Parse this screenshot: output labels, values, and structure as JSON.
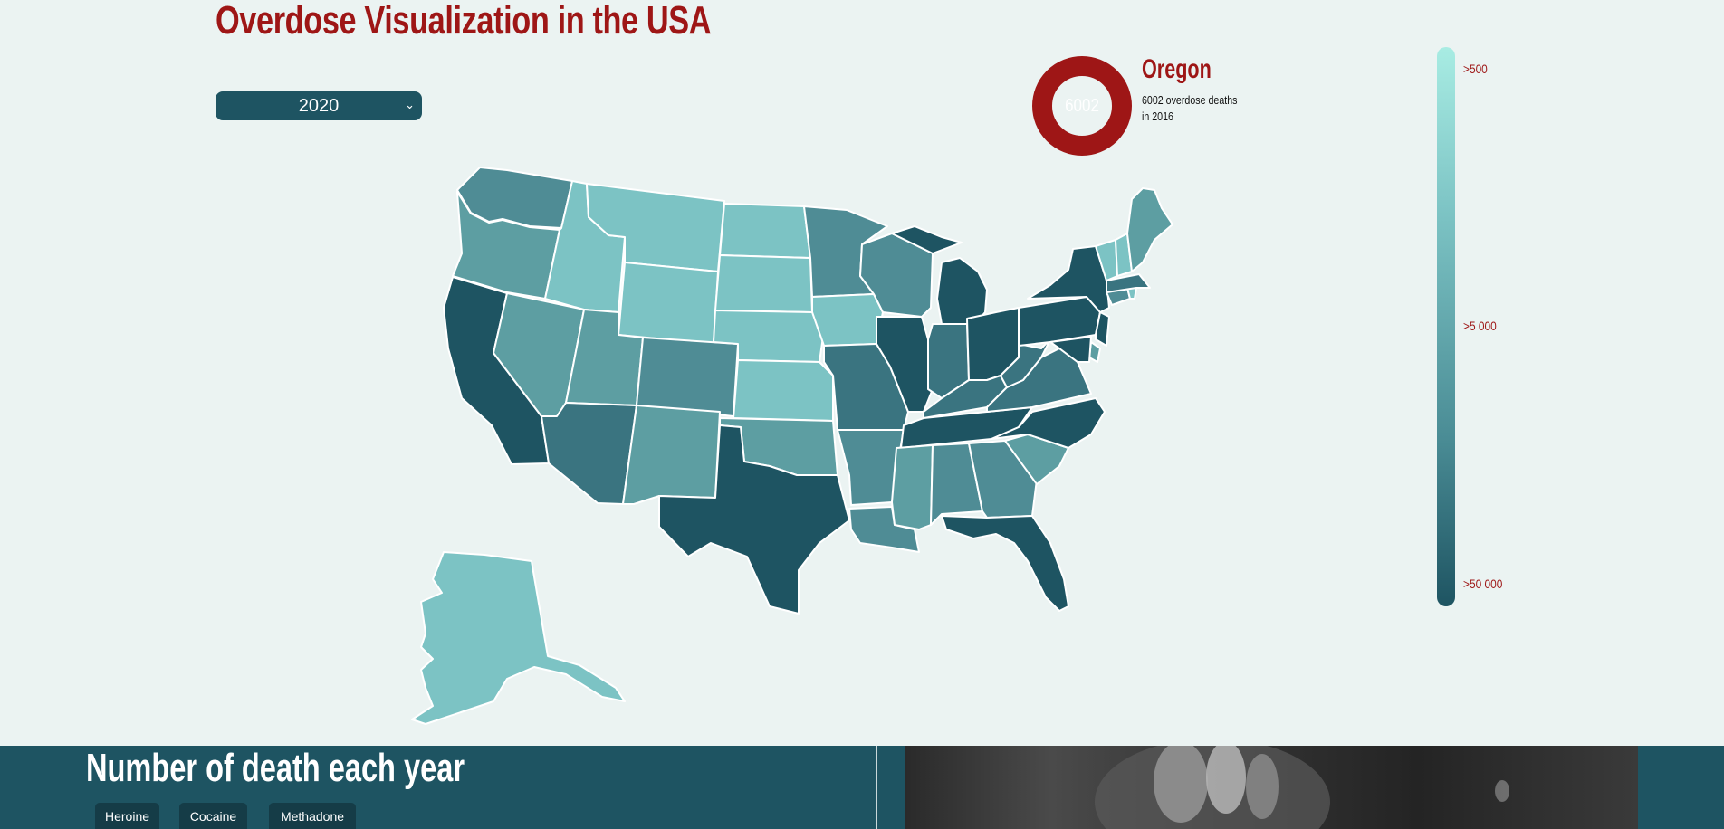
{
  "page": {
    "title": "Overdose Visualization in the USA",
    "year_selected": "2020"
  },
  "info_card": {
    "state": "Oregon",
    "count": "6002",
    "description": "6002 overdose deaths in 2016"
  },
  "legend": {
    "labels": [
      ">500",
      ">5 000",
      ">50 000"
    ],
    "colors": [
      "#a8ece3",
      "#7cc3c4",
      "#5b9fa3",
      "#4a8c95",
      "#3a7480",
      "#1e5462"
    ]
  },
  "colors": {
    "accent": "#9e1616",
    "panel": "#1e5462",
    "background": "#ebf3f2",
    "state_border": "#ffffff"
  },
  "bottom_section": {
    "title": "Number of death each year",
    "buttons": [
      "Heroine",
      "Cocaine",
      "Methadone"
    ]
  }
}
